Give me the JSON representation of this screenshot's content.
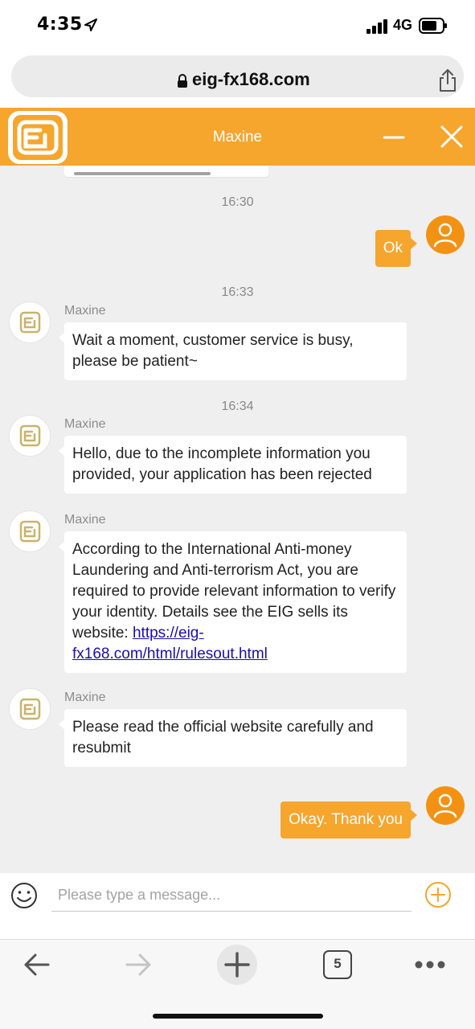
{
  "status_bar": {
    "time": "4:35",
    "network": "4G"
  },
  "browser": {
    "url": "eig-fx168.com",
    "open_tabs_count": "5"
  },
  "chat": {
    "agent_name": "Maxine",
    "timestamps": [
      "16:30",
      "16:33",
      "16:34"
    ],
    "messages": [
      {
        "from": "user",
        "text": "Ok"
      },
      {
        "from": "agent",
        "sender": "Maxine",
        "text": "Wait a moment, customer service is busy, please be patient~"
      },
      {
        "from": "agent",
        "sender": "Maxine",
        "text": "Hello, due to the incomplete information you provided, your application has been rejected"
      },
      {
        "from": "agent",
        "sender": "Maxine",
        "text": "According to the International Anti-money Laundering and Anti-terrorism Act, you are required to provide relevant information to verify your identity. Details see the EIG sells its website:",
        "link": "https://eig-fx168.com/html/rulesout.html"
      },
      {
        "from": "agent",
        "sender": "Maxine",
        "text": "Please read the official website carefully and resubmit"
      },
      {
        "from": "user",
        "text": "Okay. Thank you"
      }
    ]
  },
  "composer": {
    "placeholder": "Please type a message..."
  },
  "colors": {
    "brand_orange": "#f6a52d",
    "user_avatar": "#f39212",
    "link": "#1a0dab"
  },
  "icons": [
    "location-arrow-icon",
    "signal-icon",
    "battery-icon",
    "lock-icon",
    "share-icon",
    "eig-logo-icon",
    "minimize-icon",
    "close-icon",
    "user-icon",
    "emoji-icon",
    "plus-circle-icon",
    "back-icon",
    "forward-icon",
    "plus-icon",
    "more-icon"
  ]
}
